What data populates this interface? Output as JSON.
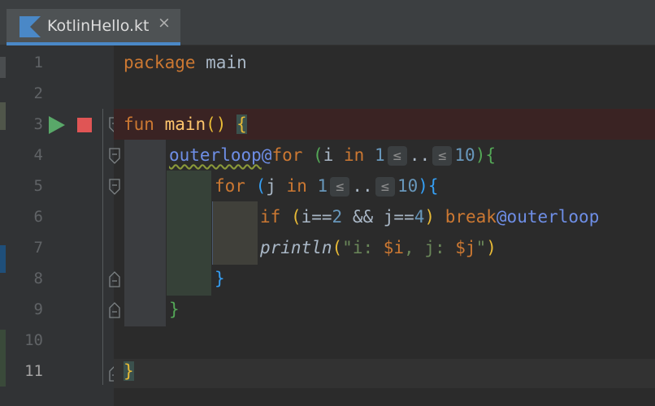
{
  "tab": {
    "title": "KotlinHello.kt",
    "close_glyph": "×",
    "icon": "kotlin-logo-icon"
  },
  "gutter": {
    "line_numbers": [
      "1",
      "2",
      "3",
      "4",
      "5",
      "6",
      "7",
      "8",
      "9",
      "10",
      "11"
    ]
  },
  "code": {
    "l1": {
      "kw": "package",
      "rest": " main"
    },
    "l3": {
      "kw": "fun",
      "name": " main",
      "paren": "()",
      "brace": "{"
    },
    "l4": {
      "label": "outerloop",
      "at": "@",
      "kw": "for",
      "sp": " ",
      "p_open": "(",
      "var": "i ",
      "in": "in",
      "n1": " 1",
      "hint1": "≤",
      "dots": "..",
      "hint2": "≤",
      "n2": "10",
      "p_close": ")",
      "brace": "{"
    },
    "l5": {
      "kw": "for",
      "sp": " ",
      "p_open": "(",
      "var": "j ",
      "in": "in",
      "n1": " 1",
      "hint1": "≤",
      "dots": "..",
      "hint2": "≤",
      "n2": "10",
      "p_close": ")",
      "brace": "{"
    },
    "l6": {
      "kw": "if",
      "sp": " ",
      "p_open": "(",
      "c1": "i==",
      "n1": "2",
      "and": " && ",
      "c2": "j==",
      "n2": "4",
      "p_close": ")",
      "sp2": " ",
      "brk": "break",
      "label": "@outerloop"
    },
    "l7": {
      "fn": "println",
      "p_open": "(",
      "str_start": "\"i: ",
      "v1": "$i",
      "str_mid": ", j: ",
      "v2": "$j",
      "str_end": "\"",
      "p_close": ")"
    },
    "l8": {
      "brace": "}"
    },
    "l9": {
      "brace": "}"
    },
    "l11": {
      "brace": "}"
    }
  },
  "colors": {
    "keyword": "#cc7832",
    "function": "#ffc66d",
    "label": "#6e8ee6",
    "number": "#6897bb",
    "string": "#6a8759",
    "text": "#a9b7c6",
    "background": "#2b2b2b",
    "gutter": "#313335",
    "tab_accent": "#4a88c7",
    "breakpoint_line": "#3a2323"
  }
}
